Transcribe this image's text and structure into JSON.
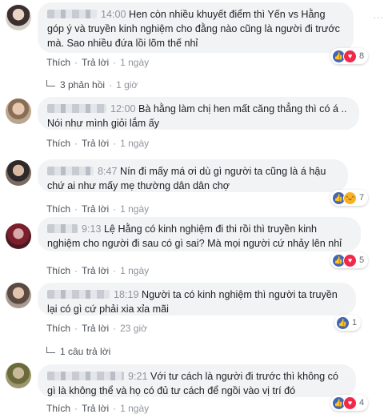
{
  "colors": {
    "like": "#4267b2",
    "love": "#f0284a",
    "haha": "#f7b125",
    "bubble_bg": "#f2f3f5"
  },
  "comments": [
    {
      "time": "14:00",
      "text": "Hen còn nhiều khuyết điểm thì Yến vs Hằng góp ý và truyền kinh nghiệm cho đằng nào cũng là người đi trước mà. Sao nhiều đứa lồi lõm thế nhỉ",
      "like_label": "Thích",
      "reply_label": "Trả lời",
      "age": "1 ngày",
      "reactions": [
        "like",
        "love"
      ],
      "reaction_count": "8",
      "replies_label": "3 phản hồi",
      "replies_age": "1 giờ"
    },
    {
      "time": "12:00",
      "text": "Bà hằng làm chị hen mất căng thẳng thì có á .. Nói như mình giỏi lắm ấy",
      "like_label": "Thích",
      "reply_label": "Trả lời",
      "age": "1 ngày"
    },
    {
      "time": "8:47",
      "text": "Nín đi mấy má ơi dù gì người ta cũng là á hậu chứ ai như mấy mẹ thường dân dân chợ",
      "like_label": "Thích",
      "reply_label": "Trả lời",
      "age": "1 ngày",
      "reactions": [
        "like",
        "haha"
      ],
      "reaction_count": "7"
    },
    {
      "time": "9:13",
      "text": "Lệ Hằng có kinh nghiệm đi thi rồi thì truyền kinh nghiệm cho người đi sau có gì sai? Mà mọi người cứ nhảy lên nhỉ",
      "like_label": "Thích",
      "reply_label": "Trả lời",
      "age": "1 ngày",
      "reactions": [
        "like",
        "love"
      ],
      "reaction_count": "5"
    },
    {
      "time": "18:19",
      "text": "Người ta có kinh nghiệm thì người ta truyền lại có gì cứ phải xia xỉa mãi",
      "like_label": "Thích",
      "reply_label": "Trả lời",
      "age": "23 giờ",
      "reactions": [
        "like"
      ],
      "reaction_count": "1",
      "replies_label": "1 câu trả lời"
    },
    {
      "time": "9:21",
      "text": "Với tư cách là người đi trước thì không có gì là không thể và họ có đủ tư cách để ngồi vào vị trí đó",
      "like_label": "Thích",
      "reply_label": "Trả lời",
      "age": "1 ngày",
      "reactions": [
        "like",
        "love"
      ],
      "reaction_count": "4"
    }
  ]
}
